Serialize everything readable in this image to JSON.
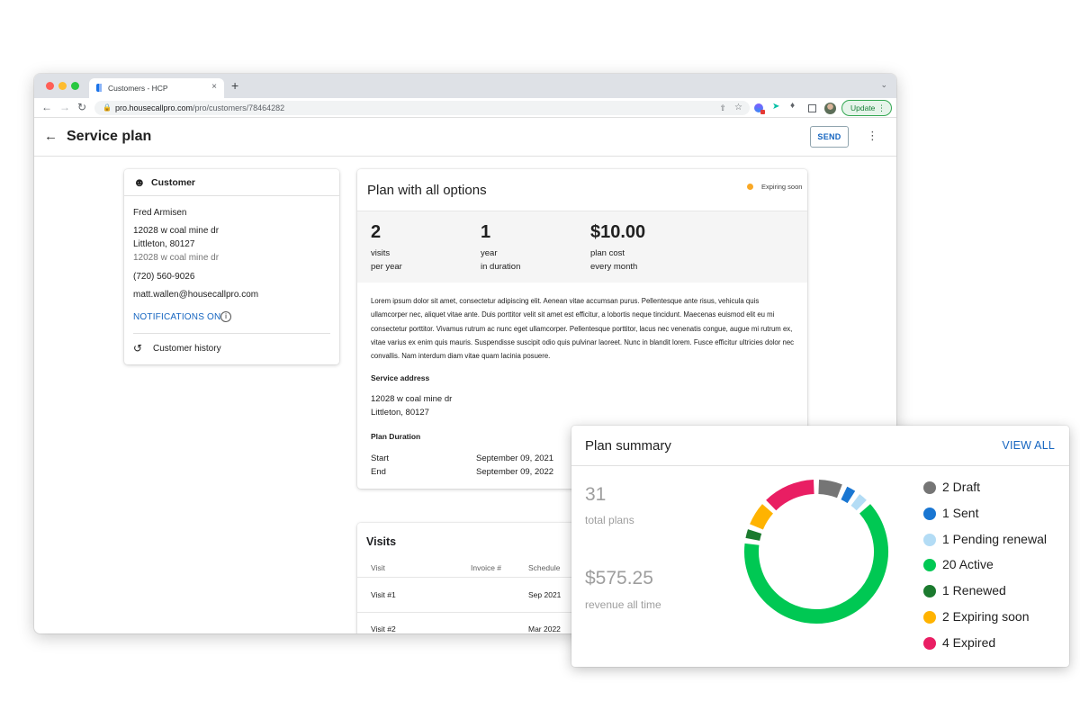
{
  "browser": {
    "tab_title": "Customers - HCP",
    "tab_close": "×",
    "new_tab": "+",
    "url_host": "pro.housecallpro.com",
    "url_path": "/pro/customers/78464282",
    "update_label": "Update"
  },
  "header": {
    "title": "Service plan",
    "send_label": "SEND"
  },
  "customer": {
    "heading": "Customer",
    "name": "Fred Armisen",
    "address_line1": "12028 w coal mine dr",
    "address_line2": "Littleton, 80127",
    "address_line3": "12028 w coal mine dr",
    "phone": "(720) 560-9026",
    "email": "matt.wallen@housecallpro.com",
    "notifications": "NOTIFICATIONS ON",
    "info_glyph": "i",
    "history": "Customer history"
  },
  "plan": {
    "title": "Plan with all options",
    "status": "Expiring soon",
    "status_color": "#f9a825",
    "stats": [
      {
        "value": "2",
        "line1": "visits",
        "line2": "per year"
      },
      {
        "value": "1",
        "line1": "year",
        "line2": "in duration"
      },
      {
        "value": "$10.00",
        "line1": "plan cost",
        "line2": "every month"
      }
    ],
    "description": "Lorem ipsum dolor sit amet, consectetur adipiscing elit. Aenean vitae accumsan purus. Pellentesque ante risus, vehicula quis ullamcorper nec, aliquet vitae ante. Duis porttitor velit sit amet est efficitur, a lobortis neque tincidunt. Maecenas euismod elit eu mi consectetur porttitor. Vivamus rutrum ac nunc eget ullamcorper. Pellentesque porttitor, lacus nec venenatis congue, augue mi rutrum ex, vitae varius ex enim quis mauris. Suspendisse suscipit odio quis pulvinar laoreet. Nunc in blandit lorem. Fusce efficitur ultricies dolor nec convallis. Nam interdum diam vitae quam lacinia posuere.",
    "service_address_label": "Service address",
    "service_address_line1": "12028 w coal mine dr",
    "service_address_line2": "Littleton, 80127",
    "duration_label": "Plan Duration",
    "start_label": "Start",
    "start_value": "September 09, 2021",
    "end_label": "End",
    "end_value": "September 09, 2022"
  },
  "visits": {
    "title": "Visits",
    "columns": [
      "Visit",
      "Invoice #",
      "Schedule"
    ],
    "rows": [
      {
        "visit": "Visit #1",
        "invoice": "",
        "schedule": "Sep 2021"
      },
      {
        "visit": "Visit #2",
        "invoice": "",
        "schedule": "Mar 2022"
      }
    ]
  },
  "summary": {
    "title": "Plan summary",
    "view_all": "VIEW ALL",
    "total_plans": "31",
    "total_plans_caption": "total plans",
    "revenue": "$575.25",
    "revenue_caption": "revenue all time",
    "legend": [
      {
        "label": "2 Draft",
        "count": 2,
        "color": "#757575"
      },
      {
        "label": "1 Sent",
        "count": 1,
        "color": "#1976d2"
      },
      {
        "label": "1 Pending renewal",
        "count": 1,
        "color": "#b3dcf5"
      },
      {
        "label": "20 Active",
        "count": 20,
        "color": "#00c853"
      },
      {
        "label": "1 Renewed",
        "count": 1,
        "color": "#1b7a2e"
      },
      {
        "label": "2 Expiring soon",
        "count": 2,
        "color": "#ffb300"
      },
      {
        "label": "4 Expired",
        "count": 4,
        "color": "#e91e63"
      }
    ]
  }
}
